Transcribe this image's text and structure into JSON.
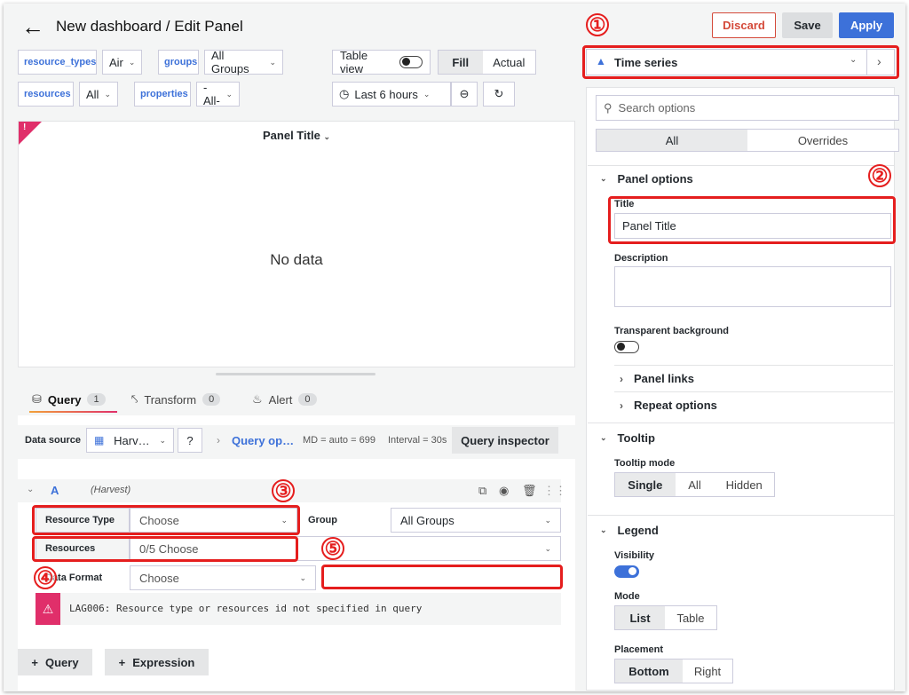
{
  "header": {
    "title": "New dashboard / Edit Panel",
    "discard": "Discard",
    "save": "Save",
    "apply": "Apply"
  },
  "variables": {
    "resource_types": {
      "label": "resource_types",
      "value": "Air"
    },
    "groups": {
      "label": "groups",
      "value": "All Groups"
    },
    "resources": {
      "label": "resources",
      "value": "All"
    },
    "properties": {
      "label": "properties",
      "value": "-All-"
    }
  },
  "view_controls": {
    "table_view": "Table view",
    "fill": "Fill",
    "actual": "Actual",
    "time_range": "Last 6 hours"
  },
  "panel": {
    "title": "Panel Title",
    "no_data": "No data",
    "warning_mark": "!"
  },
  "tabs": [
    {
      "label": "Query",
      "count": "1"
    },
    {
      "label": "Transform",
      "count": "0"
    },
    {
      "label": "Alert",
      "count": "0"
    }
  ],
  "datasource": {
    "label": "Data source",
    "value": "Harv…",
    "query_options": "Query op…",
    "md": "MD = auto = 699",
    "interval": "Interval = 30s",
    "inspector": "Query inspector"
  },
  "query": {
    "ref": "A",
    "source": "(Harvest)",
    "resource_type_label": "Resource Type",
    "resource_type_value": "Choose",
    "group_label": "Group",
    "group_value": "All Groups",
    "resources_label": "Resources",
    "resources_value": "0/5 Choose",
    "data_format_label": "Data Format",
    "data_format_value": "Choose",
    "error": "LAG006: Resource type or resources id not specified in query",
    "add_query": "Query",
    "add_expression": "Expression"
  },
  "options": {
    "viz_name": "Time series",
    "search_placeholder": "Search options",
    "tab_all": "All",
    "tab_overrides": "Overrides",
    "panel_options": "Panel options",
    "title_label": "Title",
    "title_value": "Panel Title",
    "description_label": "Description",
    "transparent_label": "Transparent background",
    "panel_links": "Panel links",
    "repeat_options": "Repeat options",
    "tooltip": "Tooltip",
    "tooltip_mode_label": "Tooltip mode",
    "tooltip_modes": [
      "Single",
      "All",
      "Hidden"
    ],
    "legend": "Legend",
    "visibility_label": "Visibility",
    "mode_label": "Mode",
    "modes": [
      "List",
      "Table"
    ],
    "placement_label": "Placement",
    "placements": [
      "Bottom",
      "Right"
    ]
  },
  "annotations": [
    "①",
    "②",
    "③",
    "④",
    "⑤"
  ],
  "colors": {
    "accent": "#3d71d9",
    "danger": "#e51e1e",
    "warning": "#e02f6a"
  }
}
